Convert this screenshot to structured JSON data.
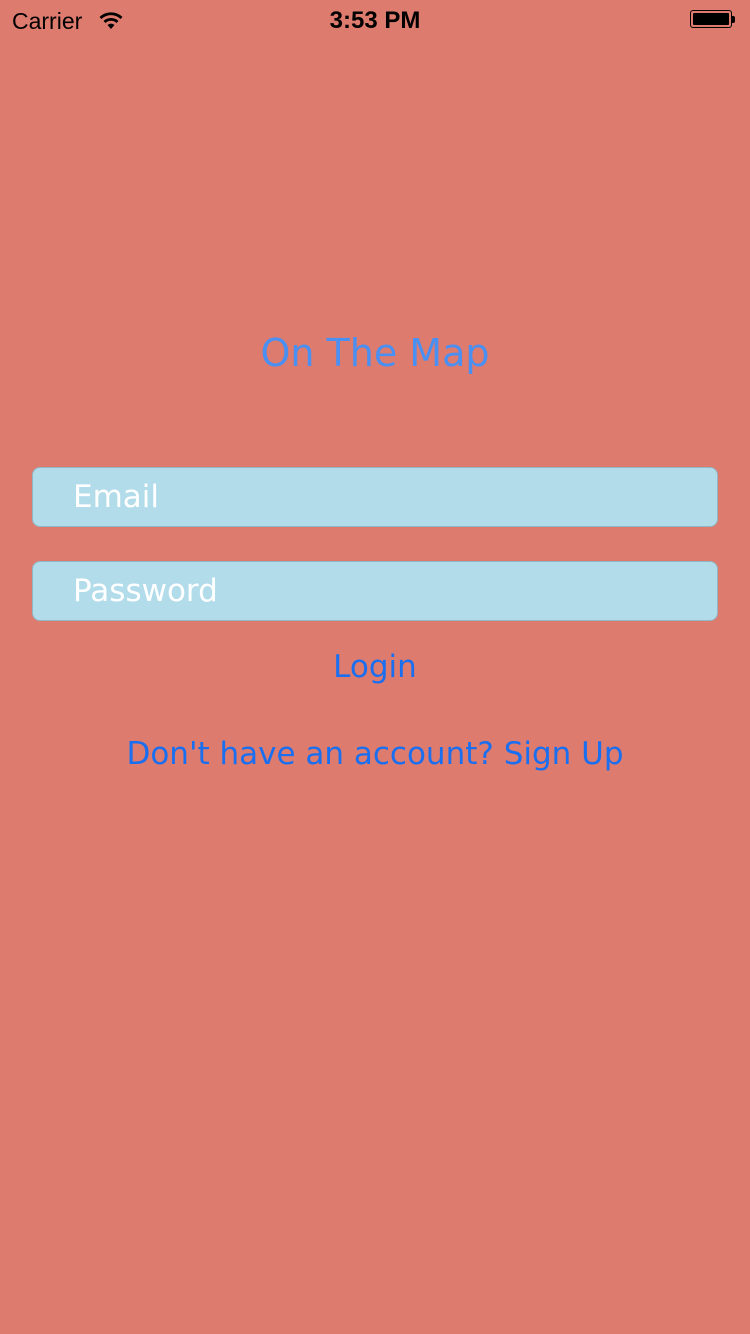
{
  "status_bar": {
    "carrier": "Carrier",
    "time": "3:53 PM",
    "wifi_icon": "wifi-icon",
    "battery_icon": "battery-icon"
  },
  "app": {
    "title": "On The Map"
  },
  "form": {
    "email_placeholder": "Email",
    "email_value": "",
    "password_placeholder": "Password",
    "password_value": "",
    "login_label": "Login",
    "signup_label": "Don't have an account? Sign Up"
  },
  "colors": {
    "background": "#de7b6f",
    "title": "#4a8ff2",
    "field_background": "#b3dceb",
    "button_text": "#1a6ff0"
  }
}
